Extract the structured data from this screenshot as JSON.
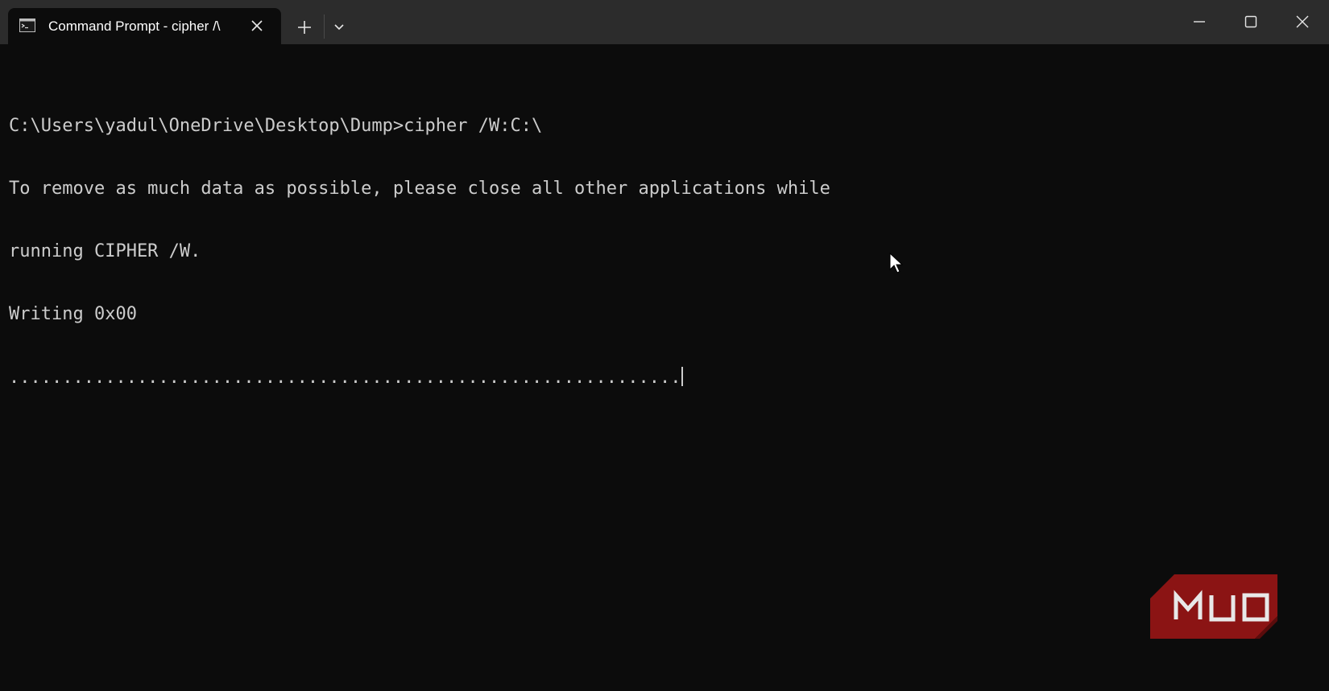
{
  "window": {
    "tab_title": "Command Prompt - cipher  /\\"
  },
  "terminal": {
    "lines": [
      "C:\\Users\\yadul\\OneDrive\\Desktop\\Dump>cipher /W:C:\\",
      "To remove as much data as possible, please close all other applications while",
      "running CIPHER /W.",
      "Writing 0x00",
      "..............................................................."
    ],
    "background": "#0c0c0c",
    "foreground": "#cccccc"
  },
  "icons": {
    "tab": "command-prompt-icon",
    "tab_close": "close-icon",
    "new_tab": "plus-icon",
    "dropdown": "chevron-down-icon",
    "minimize": "minimize-icon",
    "maximize": "maximize-icon",
    "close": "close-icon",
    "pointer": "mouse-pointer-icon"
  },
  "watermark": {
    "text": "MUO",
    "color": "#8b1414"
  },
  "colors": {
    "titlebar": "#2c2c2c",
    "tab_active": "#0c0c0c"
  }
}
